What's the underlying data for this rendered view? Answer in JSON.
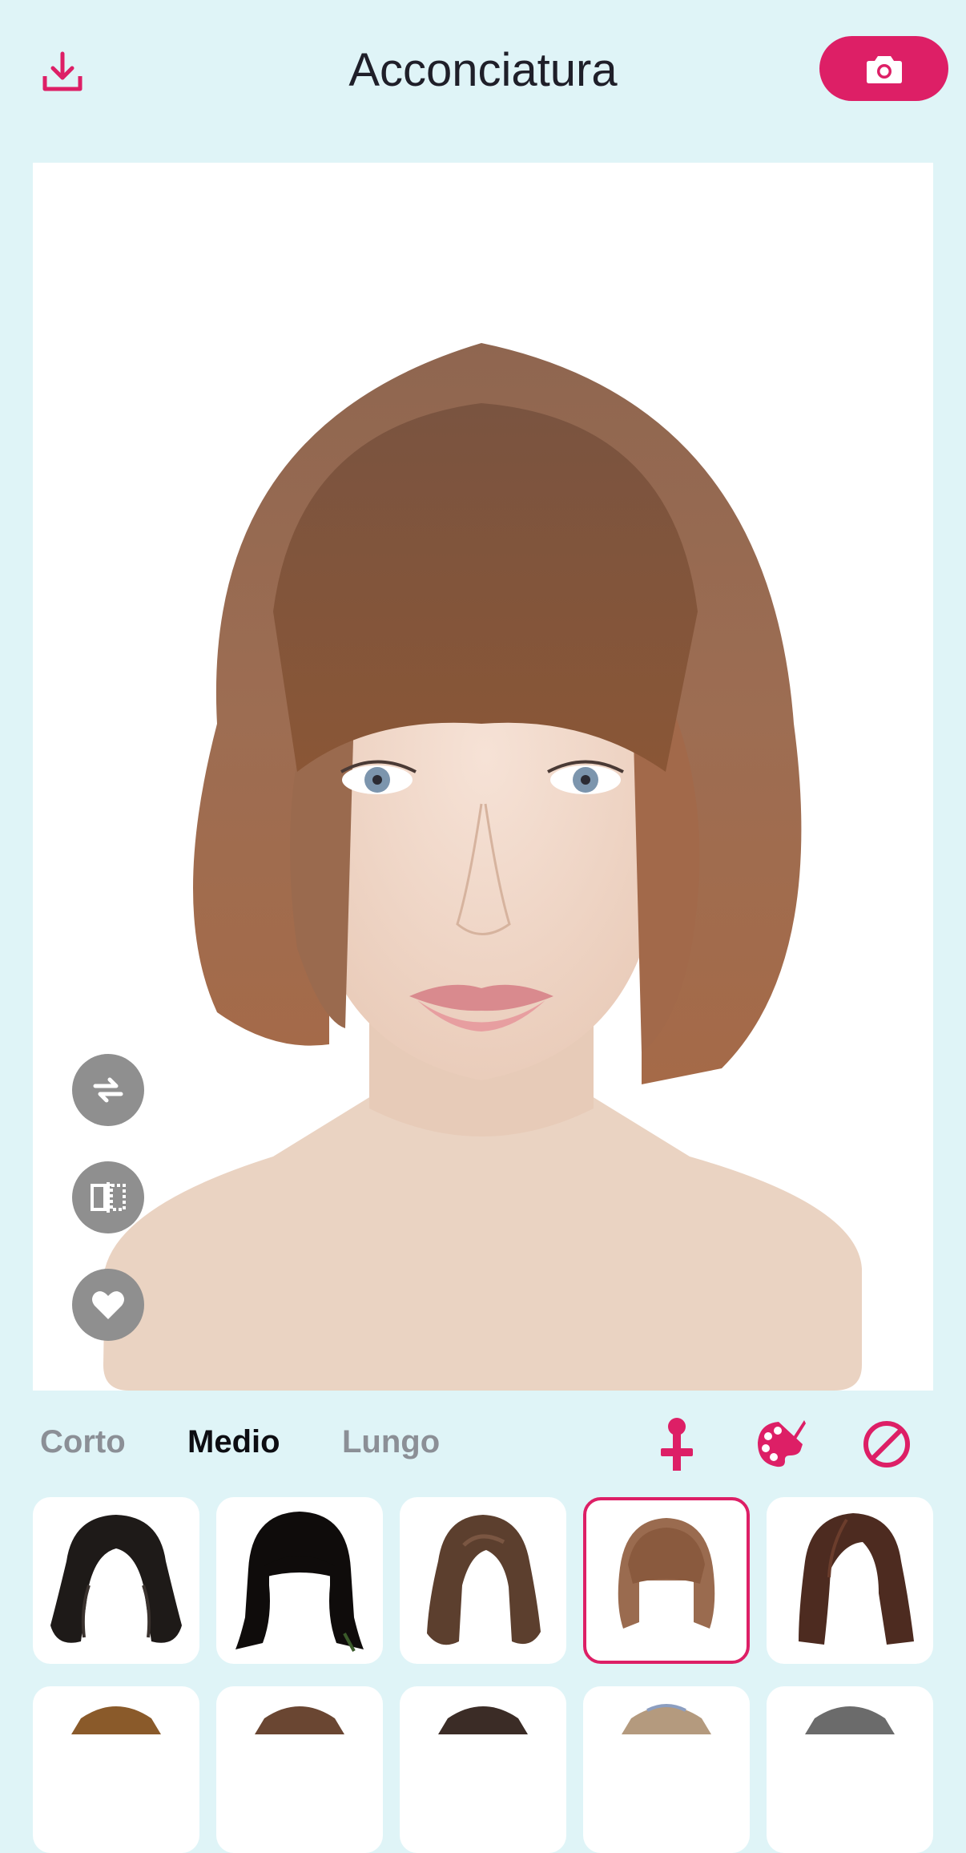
{
  "header": {
    "title": "Acconciatura",
    "download_icon": "download-icon",
    "camera_icon": "camera-icon"
  },
  "preview": {
    "tools": [
      "swap-icon",
      "mirror-compare-icon",
      "heart-icon"
    ]
  },
  "categories": {
    "tabs": [
      {
        "label": "Corto",
        "active": false
      },
      {
        "label": "Medio",
        "active": true
      },
      {
        "label": "Lungo",
        "active": false
      }
    ],
    "tools": [
      "pin-icon",
      "palette-icon",
      "no-hair-icon"
    ]
  },
  "hairstyles": {
    "selected_index": 3,
    "row1": [
      {
        "color": "#1e1a18",
        "style": "wavy"
      },
      {
        "color": "#0f0c0b",
        "style": "bangs-straight"
      },
      {
        "color": "#5c3f2e",
        "style": "wavy"
      },
      {
        "color": "#9a6b4f",
        "style": "bob-bangs"
      },
      {
        "color": "#4d2b20",
        "style": "side-part"
      }
    ],
    "row2": [
      {
        "color": "#8a5a2a"
      },
      {
        "color": "#6a4632"
      },
      {
        "color": "#3b2c26"
      },
      {
        "color": "#b49a7e"
      },
      {
        "color": "#6b6b6b"
      }
    ]
  },
  "colors": {
    "accent": "#dd1f66",
    "background": "#dff4f7",
    "tool_gray": "#8f8f8f"
  }
}
